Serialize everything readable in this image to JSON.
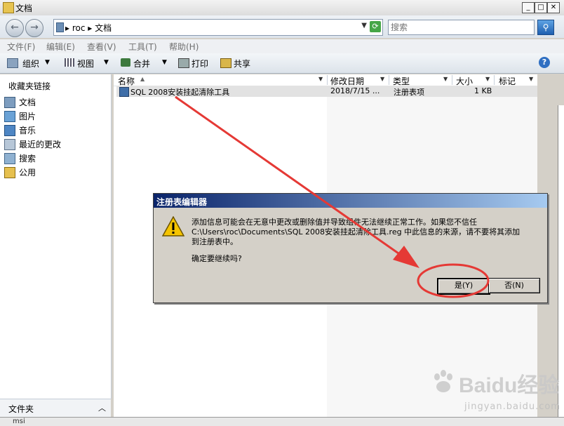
{
  "window": {
    "title": "文档"
  },
  "address": {
    "path": "▸ roc ▸ 文档",
    "search_placeholder": "搜索"
  },
  "menu": [
    "文件(F)",
    "编辑(E)",
    "查看(V)",
    "工具(T)",
    "帮助(H)"
  ],
  "toolbar": {
    "organize": "组织",
    "views": "视图",
    "merge": "合并",
    "print": "打印",
    "share": "共享"
  },
  "nav": {
    "favorites_title": "收藏夹链接",
    "items": [
      "文档",
      "图片",
      "音乐",
      "最近的更改",
      "搜索",
      "公用"
    ],
    "folders_label": "文件夹"
  },
  "columns": [
    "名称",
    "修改日期",
    "类型",
    "大小",
    "标记"
  ],
  "files": [
    {
      "name": "SQL 2008安装挂起清除工具",
      "date": "2018/7/15 ...",
      "type": "注册表项",
      "size": "1 KB"
    }
  ],
  "dialog": {
    "title": "注册表编辑器",
    "message": "添加信息可能会在无意中更改或删除值并导致组件无法继续正常工作。如果您不信任\nC:\\Users\\roc\\Documents\\SQL 2008安装挂起清除工具.reg 中此信息的来源，请不要将其添加\n到注册表中。",
    "confirm": "确定要继续吗?",
    "yes": "是(Y)",
    "no": "否(N)"
  },
  "watermark": {
    "brand": "Baidu经验",
    "url": "jingyan.baidu.com"
  },
  "bottom_strip_text": "msi",
  "colors": {
    "annotation": "#e53935",
    "dialog_title": "#0a246a"
  }
}
